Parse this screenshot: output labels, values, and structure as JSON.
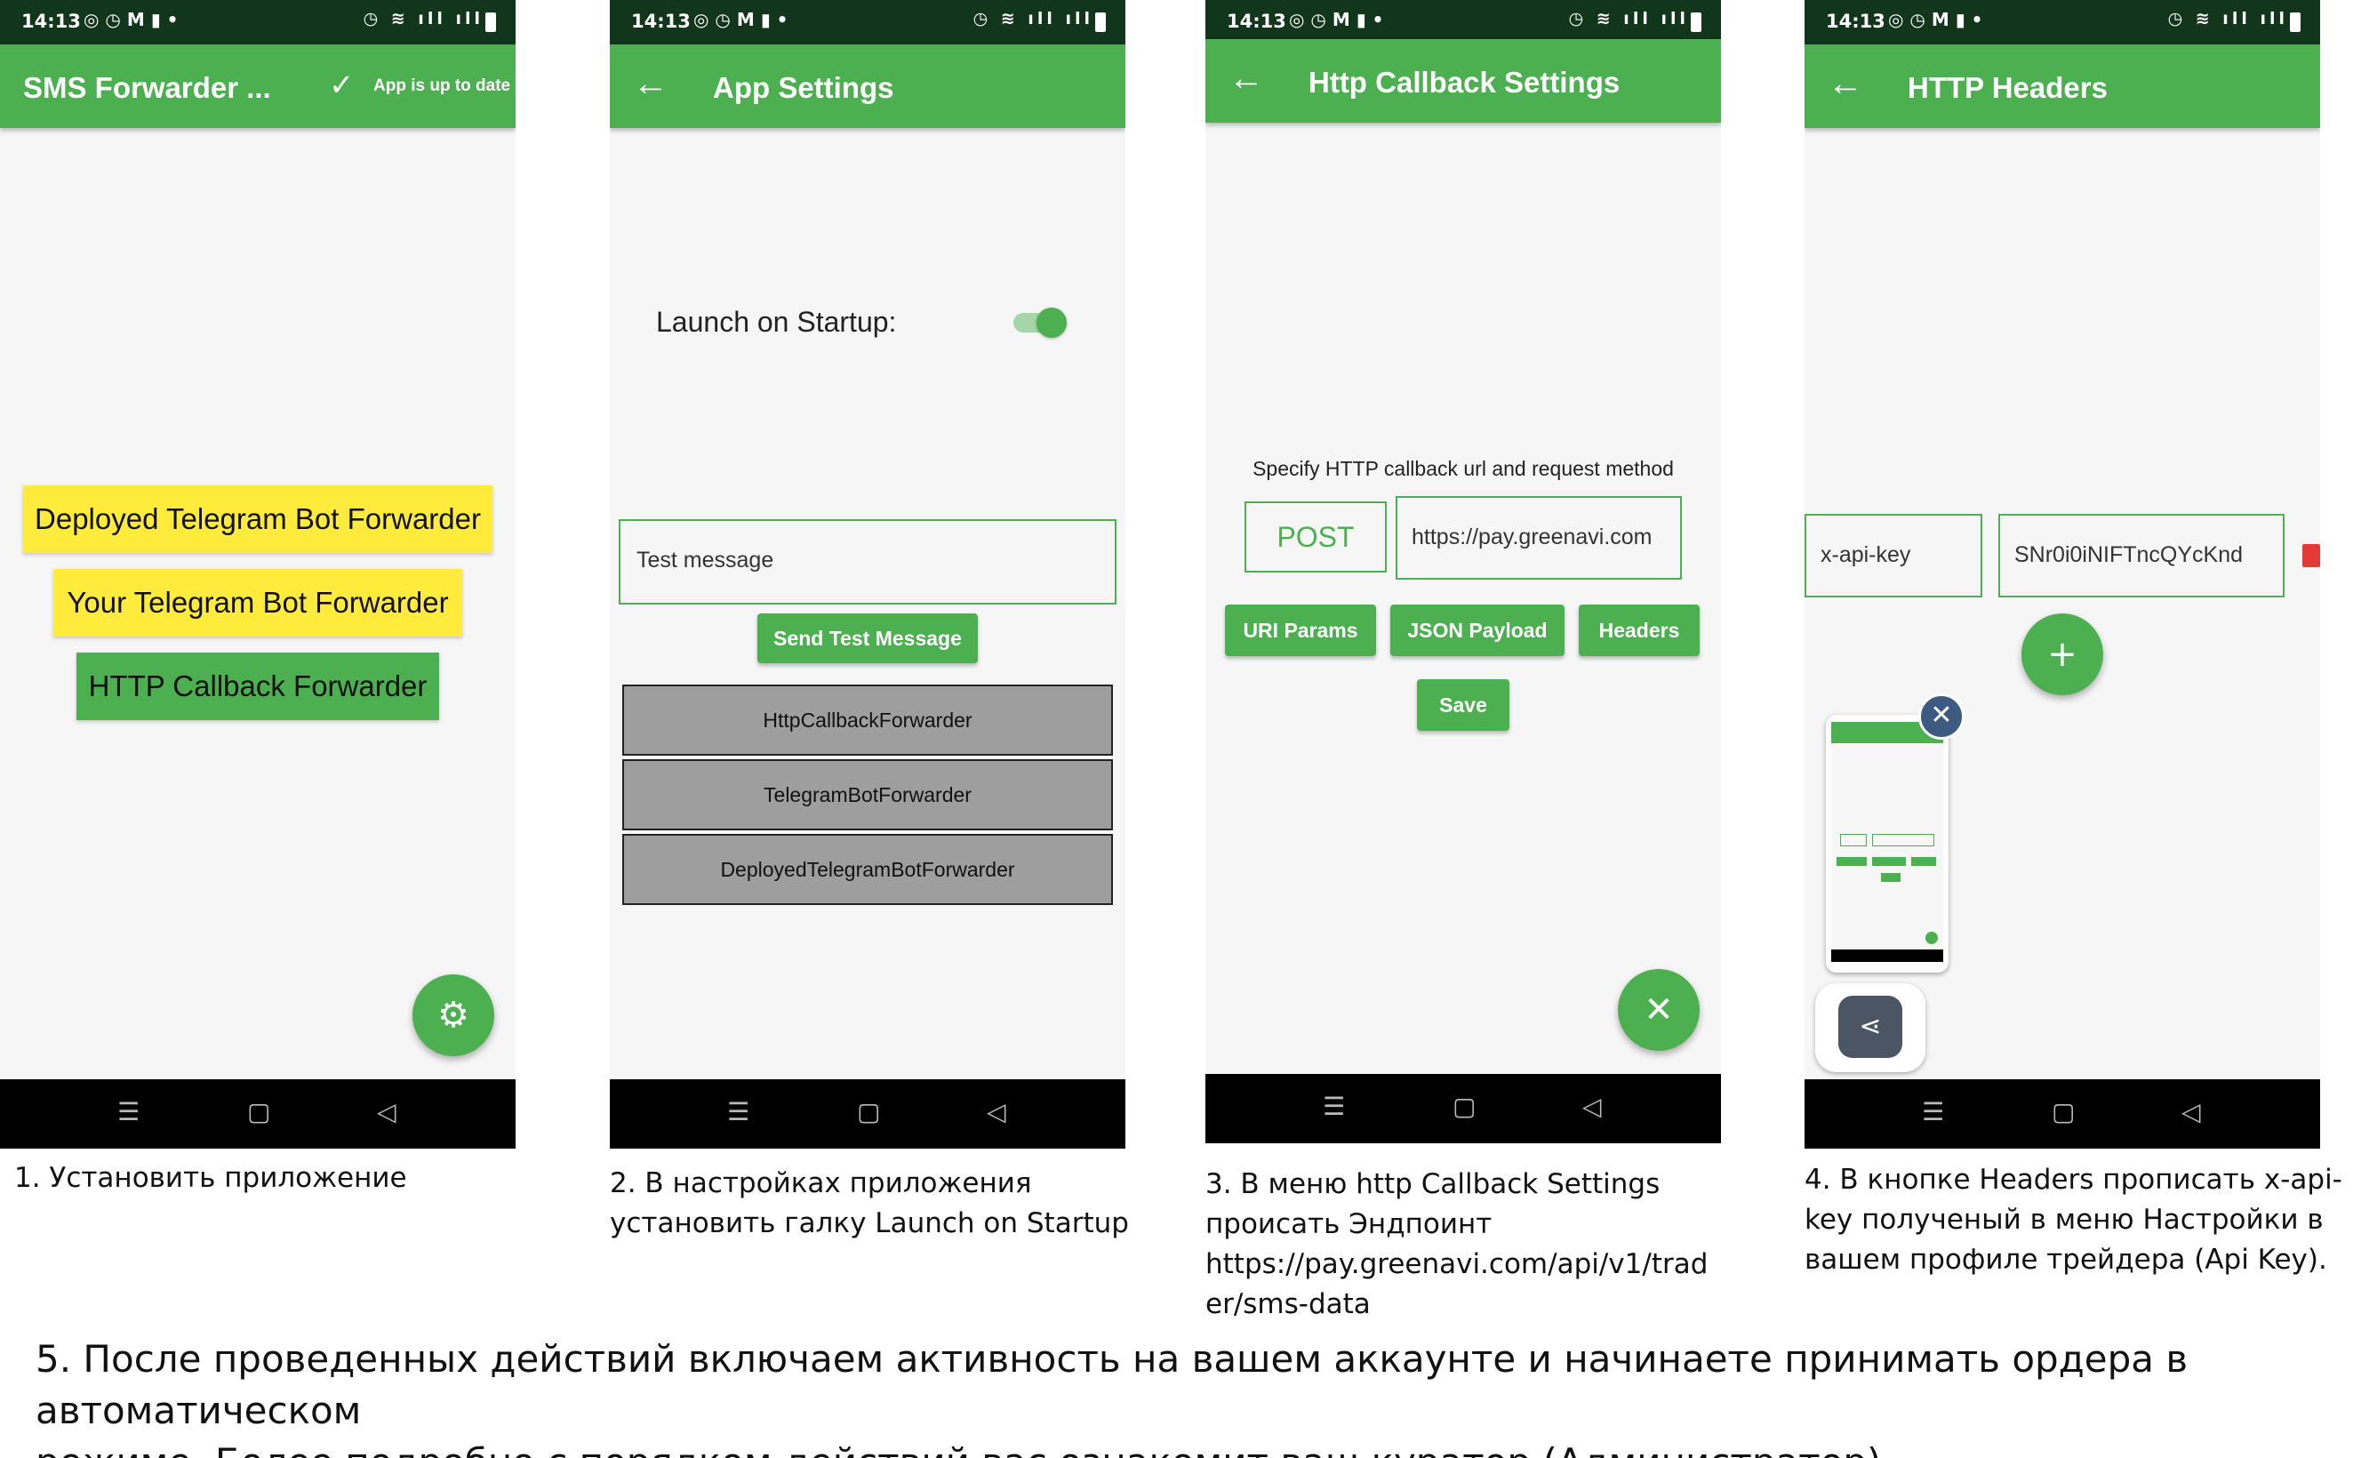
{
  "status": {
    "time": "14:13"
  },
  "panel1": {
    "title": "SMS Forwarder ...",
    "update_status": "App is up to date",
    "buttons": [
      "Deployed Telegram Bot Forwarder",
      "Your Telegram Bot Forwarder",
      "HTTP Callback Forwarder"
    ],
    "caption": "1. Установить приложение"
  },
  "panel2": {
    "title": "App Settings",
    "launch_label": "Launch on Startup:",
    "launch_enabled": true,
    "test_message_value": "Test message",
    "send_button": "Send Test Message",
    "forwarders": [
      "HttpCallbackForwarder",
      "TelegramBotForwarder",
      "DeployedTelegramBotForwarder"
    ],
    "caption_line1": "2. В настройках приложения",
    "caption_line2": "установить галку Launch on Startup"
  },
  "panel3": {
    "title": "Http Callback Settings",
    "instruction": "Specify HTTP callback url and request method",
    "method": "POST",
    "url_value": "https://pay.greenavi.com",
    "tabs": [
      "URI Params",
      "JSON Payload",
      "Headers"
    ],
    "save_button": "Save",
    "caption_line1": "3. В меню http Callback Settings",
    "caption_line2": "происать Эндпоинт",
    "caption_line3": "https://pay.greenavi.com/api/v1/trad",
    "caption_line4": "er/sms-data"
  },
  "panel4": {
    "title": "HTTP Headers",
    "header_key": "x-api-key",
    "header_value": "SNr0i0iNIFTncQYcKnd",
    "caption_line1": "4. В кнопке Headers прописать x-api-",
    "caption_line2": "key полученый в меню Настройки в",
    "caption_line3": "вашем профиле трейдера (Api Key)."
  },
  "footer": {
    "line1": "5. После проведенных действий включаем активность на вашем аккаунте и начинаете принимать ордера в автоматическом",
    "line2": "режиме. Более подробно с порядком действий вас ознакомит ваш куратор (Администратор)."
  },
  "colors": {
    "accent": "#4caf50",
    "status_bar": "#12361c",
    "yellow": "#ffeb3b",
    "delete": "#e53935"
  }
}
